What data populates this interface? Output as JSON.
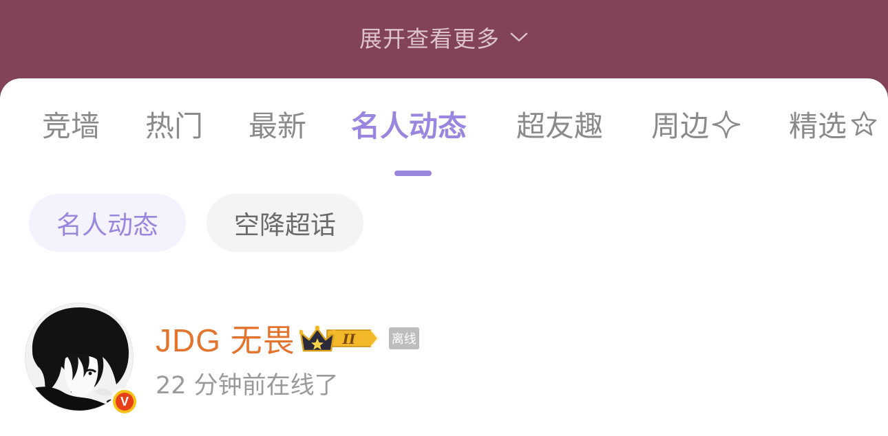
{
  "banner": {
    "expand_label": "展开查看更多",
    "chevron_icon": "chevron-down-icon"
  },
  "tabs": [
    {
      "label": "竞墙"
    },
    {
      "label": "热门"
    },
    {
      "label": "最新"
    },
    {
      "label": "名人动态",
      "active": true
    },
    {
      "label": "超友趣"
    },
    {
      "label": "周边",
      "icon": "sparkle-star-icon"
    },
    {
      "label": "精选",
      "icon": "star-badge-icon"
    }
  ],
  "chips": [
    {
      "label": "名人动态",
      "active": true
    },
    {
      "label": "空降超话"
    }
  ],
  "user": {
    "name": "JDG 无畏",
    "level_badge": "II",
    "status": "离线",
    "last_online": "22 分钟前在线了",
    "verified_mark": "V"
  },
  "colors": {
    "banner_bg": "#824258",
    "accent": "#9a86de",
    "username": "#e4732d",
    "muted_text": "#8a8a8a"
  }
}
